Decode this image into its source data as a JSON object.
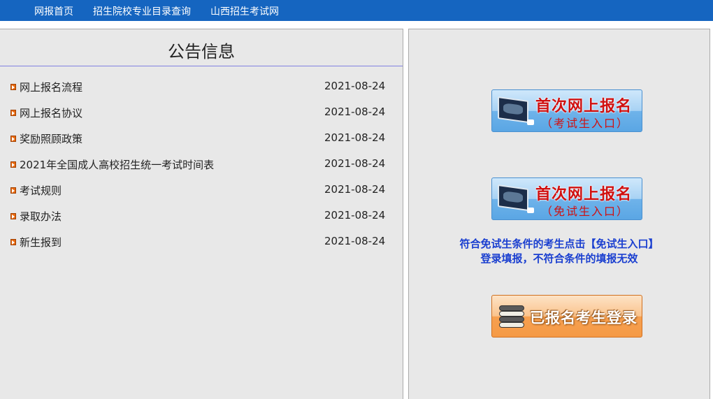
{
  "nav": {
    "items": [
      "网报首页",
      "招生院校专业目录查询",
      "山西招生考试网"
    ]
  },
  "notices": {
    "title": "公告信息",
    "items": [
      {
        "title": "网上报名流程",
        "date": "2021-08-24"
      },
      {
        "title": "网上报名协议",
        "date": "2021-08-24"
      },
      {
        "title": "奖励照顾政策",
        "date": "2021-08-24"
      },
      {
        "title": "2021年全国成人高校招生统一考试时间表",
        "date": "2021-08-24"
      },
      {
        "title": "考试规则",
        "date": "2021-08-24"
      },
      {
        "title": "录取办法",
        "date": "2021-08-24"
      },
      {
        "title": "新生报到",
        "date": "2021-08-24"
      }
    ]
  },
  "actions": {
    "exam_register": {
      "main": "首次网上报名",
      "sub": "（考试生入口）"
    },
    "exempt_register": {
      "main": "首次网上报名",
      "sub": "（免试生入口）"
    },
    "hint_line1": "符合免试生条件的考生点击【免试生入口】",
    "hint_line2": "登录填报，不符合条件的填报无效",
    "login": "已报名考生登录"
  },
  "colors": {
    "nav_bg": "#1565c0",
    "panel_bg": "#e8e8e8",
    "hint_text": "#1a3fd0",
    "register_text": "#d01010"
  }
}
